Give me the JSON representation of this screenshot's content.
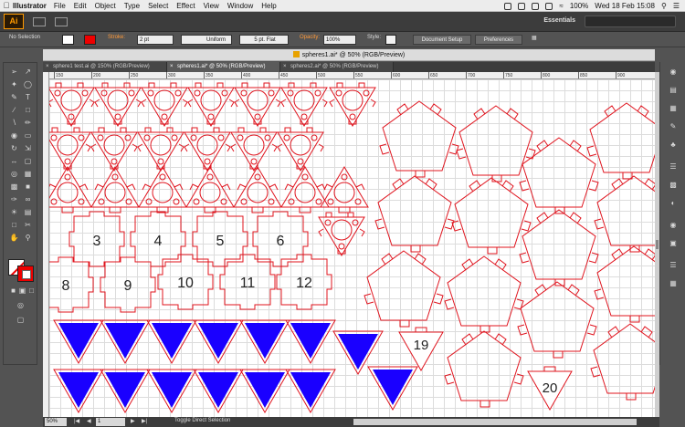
{
  "menubar": {
    "apple_icon": "apple-icon",
    "app_name": "Illustrator",
    "items": [
      "File",
      "Edit",
      "Object",
      "Type",
      "Select",
      "Effect",
      "View",
      "Window",
      "Help"
    ],
    "battery": "100%",
    "clock": "Wed 18 Feb  15:08"
  },
  "appbar": {
    "logo": "Ai",
    "workspace": "Essentials"
  },
  "controlbar": {
    "selection": "No Selection",
    "stroke_label": "Stroke:",
    "stroke_weight": "2 pt",
    "profile": "Uniform",
    "brush": "5 pt. Flat",
    "opacity_label": "Opacity:",
    "opacity_value": "100%",
    "style_label": "Style:",
    "doc_setup": "Document Setup",
    "preferences": "Preferences"
  },
  "document": {
    "title": "spheres1.ai* @ 50% (RGB/Preview)",
    "tabs": [
      {
        "label": "sphere1 test.ai @ 150% (RGB/Preview)",
        "active": false
      },
      {
        "label": "spheres1.ai* @ 50% (RGB/Preview)",
        "active": true
      },
      {
        "label": "spheres2.ai* @ 50% (RGB/Preview)",
        "active": false
      }
    ]
  },
  "ruler": {
    "ticks": [
      "150",
      "200",
      "250",
      "300",
      "350",
      "400",
      "450",
      "500",
      "550",
      "600",
      "650",
      "700",
      "750",
      "800",
      "850",
      "900"
    ]
  },
  "artwork": {
    "stroke_color": "#e0141e",
    "fill_color": "#1a00ff",
    "square_numbers": [
      "3",
      "4",
      "5",
      "6",
      "8",
      "9",
      "10",
      "11",
      "12"
    ],
    "triangle_numbers": [
      "19",
      "20"
    ]
  },
  "statusbar": {
    "zoom": "50%",
    "artboard": "1",
    "tool_hint": "Toggle Direct Selection"
  }
}
